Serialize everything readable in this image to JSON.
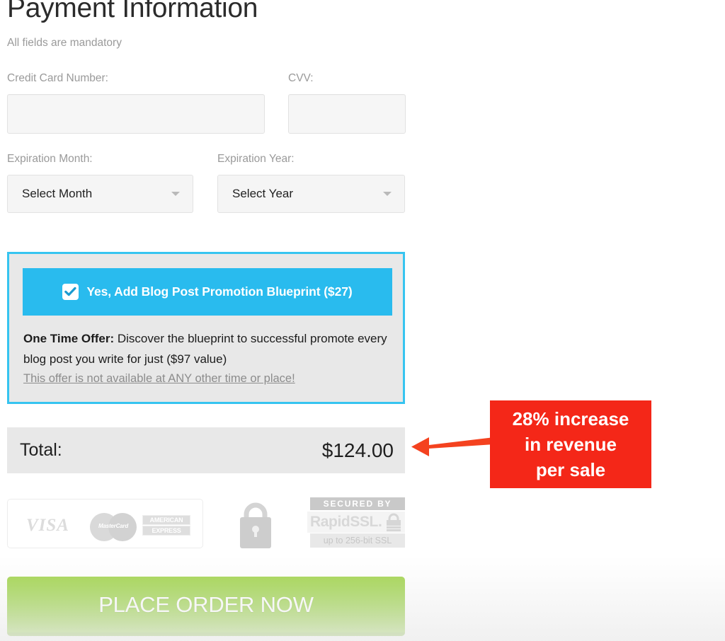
{
  "header": {
    "title": "Payment Information",
    "subtitle": "All fields are mandatory"
  },
  "form": {
    "credit_card_label": "Credit Card Number:",
    "credit_card_value": "",
    "credit_card_placeholder": "",
    "cvv_label": "CVV:",
    "cvv_value": "",
    "cvv_placeholder": "",
    "exp_month_label": "Expiration Month:",
    "exp_month_value": "Select Month",
    "exp_year_label": "Expiration Year:",
    "exp_year_value": "Select Year"
  },
  "offer": {
    "cta_label": "Yes, Add Blog Post Promotion Blueprint ($27)",
    "checked": true,
    "body_lead": "One Time Offer:",
    "body_text": " Discover the blueprint to successful promote every blog post you write for just ($97 value)",
    "note": "This offer is not available at ANY other time or place!",
    "border_color": "#36c4f0",
    "cta_color": "#29bbee"
  },
  "total": {
    "label": "Total:",
    "value": "$124.00"
  },
  "annotation": {
    "lines": [
      "28% increase",
      "in revenue",
      "per sale"
    ],
    "color": "#f42718"
  },
  "badges": {
    "visa": "VISA",
    "mastercard": "MasterCard",
    "amex_line1": "AMERICAN",
    "amex_line2": "EXPRESS",
    "lock": "padlock-icon",
    "rapidssl_top": "SECURED BY",
    "rapidssl_name": "RapidSSL.",
    "rapidssl_bottom": "up to 256-bit SSL"
  },
  "cta": {
    "order_label": "PLACE ORDER NOW",
    "color": "#8ccb2f"
  }
}
